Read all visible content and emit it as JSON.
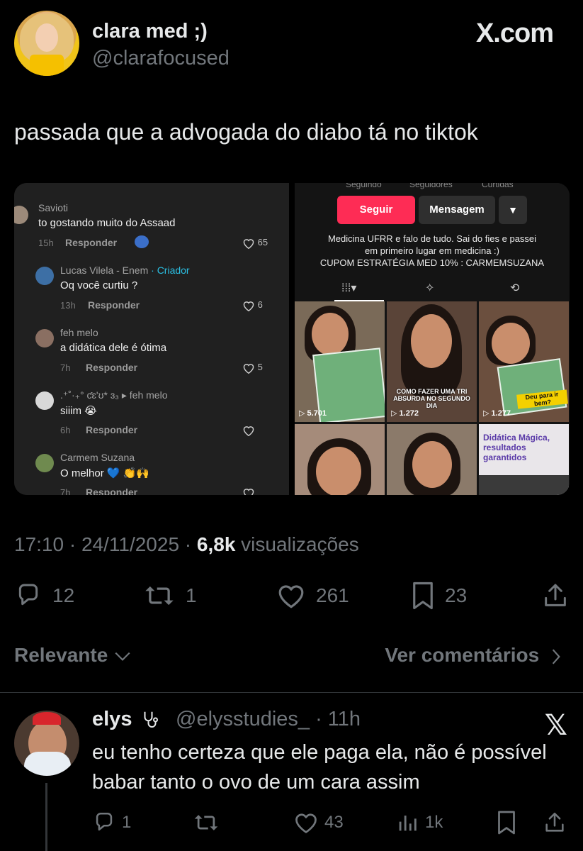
{
  "header": {
    "display_name": "clara med ;)",
    "handle": "@clarafocused",
    "site": "X.com"
  },
  "tweet": {
    "text": "passada que a advogada do diabo tá no tiktok"
  },
  "media": {
    "comments": [
      {
        "name": "Savioti",
        "text": "to gostando muito do Assaad",
        "time": "15h",
        "reply": "Responder",
        "likes": "65"
      },
      {
        "name": "Lucas Vilela - Enem",
        "badge": "· Criador",
        "text": "Oq você curtiu ?",
        "time": "13h",
        "reply": "Responder",
        "likes": "6"
      },
      {
        "name": "feh melo",
        "text": "a didática dele é ótima",
        "time": "7h",
        "reply": "Responder",
        "likes": "5"
      },
      {
        "name": ".⁺˚·₊° ƈɛ'ʊ* ɜ₃ ▸ feh melo",
        "text": "siiim 😭",
        "time": "6h",
        "reply": "Responder",
        "likes": ""
      },
      {
        "name": "Carmem Suzana",
        "text": "O melhor 💙 👏🙌",
        "time": "7h",
        "reply": "Responder",
        "likes": ""
      }
    ],
    "profile": {
      "stats_labels": [
        "Seguindo",
        "Seguidores",
        "Curtidas"
      ],
      "follow": "Seguir",
      "message": "Mensagem",
      "bio_lines": [
        "Medicina UFRR e falo de tudo. Sai do fies e passei",
        "em primeiro lugar em medicina :)",
        "CUPOM ESTRATÉGIA MED 10% : CARMEMSUZANA"
      ],
      "videos": [
        {
          "views": "▷ 5.701",
          "caption": ""
        },
        {
          "views": "▷ 1.272",
          "caption": "COMO FAZER UMA TRI ABSURDA NO SEGUNDO DIA"
        },
        {
          "views": "▷ 1.277",
          "caption": "Deu para ir bem?"
        },
        {
          "views": "",
          "caption": ""
        },
        {
          "views": "",
          "caption": ""
        },
        {
          "views": "",
          "caption": "Didática Mágica, resultados garantidos"
        }
      ]
    }
  },
  "meta": {
    "time": "17:10 · 24/11/2025 · ",
    "views_count": "6,8k",
    "views_label": " visualizações"
  },
  "actions": {
    "replies": "12",
    "retweets": "1",
    "likes": "261",
    "bookmarks": "23"
  },
  "sort": {
    "label": "Relevante",
    "view_comments": "Ver comentários"
  },
  "reply": {
    "name": "elys",
    "handle": "@elysstudies_ · 11h",
    "text": "eu tenho certeza que ele paga ela, não é possível babar tanto o ovo de um cara assim",
    "replies": "1",
    "likes": "43",
    "views": "1k"
  },
  "colors": {
    "background": "#000000",
    "muted": "#71767b",
    "tiktok_red": "#fe2c55",
    "creator_blue": "#2bc0e4"
  }
}
